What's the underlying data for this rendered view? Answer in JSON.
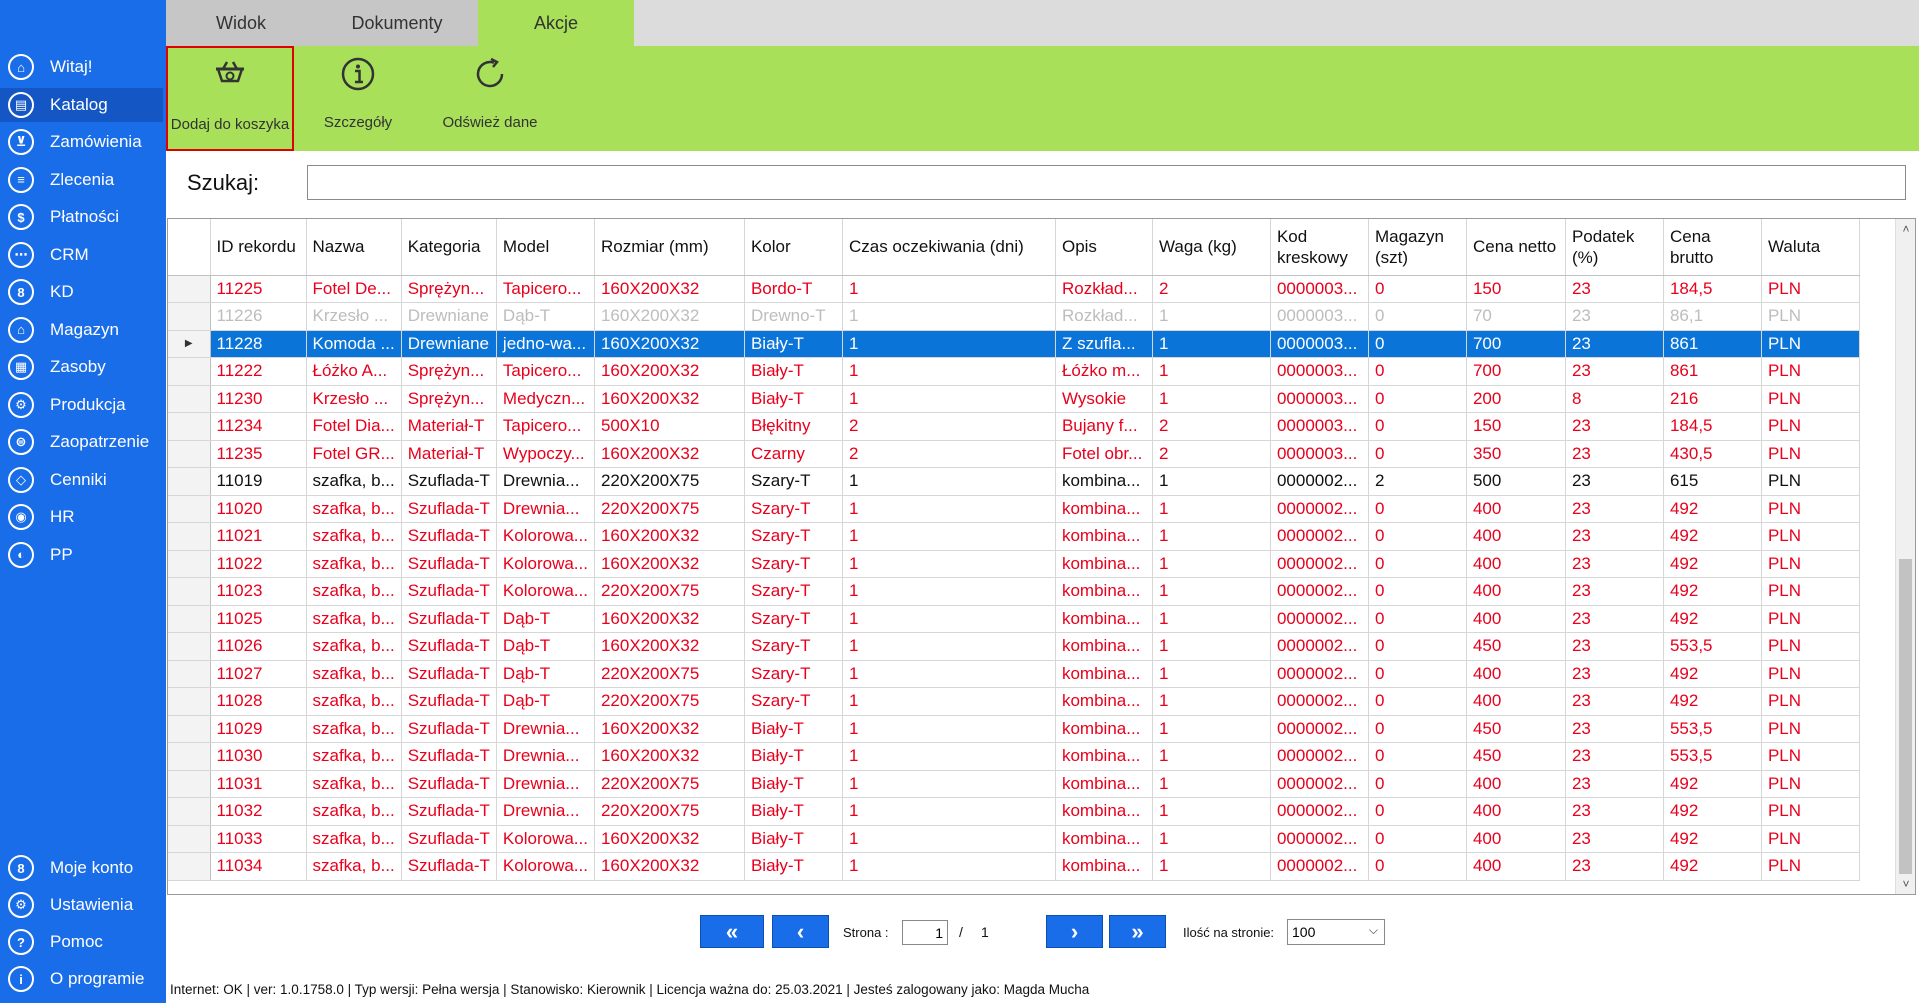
{
  "tabs": [
    "Widok",
    "Dokumenty",
    "Akcje"
  ],
  "ribbon": {
    "add_to_cart": "Dodaj do koszyka",
    "details": "Szczegóły",
    "refresh": "Odśwież dane",
    "icons": [
      "cart-icon",
      "info-icon",
      "refresh-icon"
    ]
  },
  "sidebar": {
    "items": [
      {
        "label": "Witaj!",
        "icon": "home-icon",
        "glyph": "⌂"
      },
      {
        "label": "Katalog",
        "icon": "book-icon",
        "glyph": "▤"
      },
      {
        "label": "Zamówienia",
        "icon": "cart-icon",
        "glyph": "⊻"
      },
      {
        "label": "Zlecenia",
        "icon": "list-icon",
        "glyph": "≡"
      },
      {
        "label": "Płatności",
        "icon": "dollar-icon",
        "glyph": "$"
      },
      {
        "label": "CRM",
        "icon": "crm-icon",
        "glyph": "⋯"
      },
      {
        "label": "KD",
        "icon": "person-icon",
        "glyph": "8"
      },
      {
        "label": "Magazyn",
        "icon": "warehouse-icon",
        "glyph": "⌂"
      },
      {
        "label": "Zasoby",
        "icon": "resources-icon",
        "glyph": "▦"
      },
      {
        "label": "Produkcja",
        "icon": "production-icon",
        "glyph": "⚙"
      },
      {
        "label": "Zaopatrzenie",
        "icon": "truck-icon",
        "glyph": "⊜"
      },
      {
        "label": "Cenniki",
        "icon": "tag-icon",
        "glyph": "◇"
      },
      {
        "label": "HR",
        "icon": "hr-icon",
        "glyph": "◉"
      },
      {
        "label": "PP",
        "icon": "pp-icon",
        "glyph": "◐"
      }
    ],
    "bottom_items": [
      {
        "label": "Moje konto",
        "icon": "account-icon",
        "glyph": "8"
      },
      {
        "label": "Ustawienia",
        "icon": "settings-icon",
        "glyph": "⚙"
      },
      {
        "label": "Pomoc",
        "icon": "help-icon",
        "glyph": "?"
      },
      {
        "label": "O programie",
        "icon": "about-icon",
        "glyph": "i"
      }
    ],
    "active_index": 1
  },
  "search": {
    "label": "Szukaj:",
    "value": ""
  },
  "table": {
    "columns": [
      "ID rekordu",
      "Nazwa",
      "Kategoria",
      "Model",
      "Rozmiar (mm)",
      "Kolor",
      "Czas oczekiwania (dni)",
      "Opis",
      "Waga (kg)",
      "Kod kreskowy",
      "Magazyn (szt)",
      "Cena netto",
      "Podatek (%)",
      "Cena brutto",
      "Waluta"
    ],
    "rows": [
      {
        "style": "red",
        "cells": [
          "11225",
          "Fotel De...",
          "Sprężyn...",
          "Tapicero...",
          "160X200X32",
          "Bordo-T",
          "1",
          "Rozkład...",
          "2",
          "0000003...",
          "0",
          "150",
          "23",
          "184,5",
          "PLN"
        ]
      },
      {
        "style": "grey",
        "cells": [
          "11226",
          "Krzesło ...",
          "Drewniane",
          "Dąb-T",
          "160X200X32",
          "Drewno-T",
          "1",
          "Rozkład...",
          "1",
          "0000003...",
          "0",
          "70",
          "23",
          "86,1",
          "PLN"
        ]
      },
      {
        "style": "selected",
        "cells": [
          "11228",
          "Komoda ...",
          "Drewniane",
          "jedno-wa...",
          "160X200X32",
          "Biały-T",
          "1",
          "Z szufla...",
          "1",
          "0000003...",
          "0",
          "700",
          "23",
          "861",
          "PLN"
        ]
      },
      {
        "style": "red",
        "cells": [
          "11222",
          "Łóżko A...",
          "Sprężyn...",
          "Tapicero...",
          "160X200X32",
          "Biały-T",
          "1",
          "Łóżko m...",
          "1",
          "0000003...",
          "0",
          "700",
          "23",
          "861",
          "PLN"
        ]
      },
      {
        "style": "red",
        "cells": [
          "11230",
          "Krzesło ...",
          "Sprężyn...",
          "Medyczn...",
          "160X200X32",
          "Biały-T",
          "1",
          "Wysokie",
          "1",
          "0000003...",
          "0",
          "200",
          "8",
          "216",
          "PLN"
        ]
      },
      {
        "style": "red",
        "cells": [
          "11234",
          "Fotel Dia...",
          "Materiał-T",
          "Tapicero...",
          "500X10",
          "Błękitny",
          "2",
          "Bujany f...",
          "2",
          "0000003...",
          "0",
          "150",
          "23",
          "184,5",
          "PLN"
        ]
      },
      {
        "style": "red",
        "cells": [
          "11235",
          "Fotel GR...",
          "Materiał-T",
          "Wypoczy...",
          "160X200X32",
          "Czarny",
          "2",
          "Fotel obr...",
          "2",
          "0000003...",
          "0",
          "350",
          "23",
          "430,5",
          "PLN"
        ]
      },
      {
        "style": "black",
        "cells": [
          "11019",
          "szafka, b...",
          "Szuflada-T",
          "Drewnia...",
          "220X200X75",
          "Szary-T",
          "1",
          "kombina...",
          "1",
          "0000002...",
          "2",
          "500",
          "23",
          "615",
          "PLN"
        ]
      },
      {
        "style": "red",
        "cells": [
          "11020",
          "szafka, b...",
          "Szuflada-T",
          "Drewnia...",
          "220X200X75",
          "Szary-T",
          "1",
          "kombina...",
          "1",
          "0000002...",
          "0",
          "400",
          "23",
          "492",
          "PLN"
        ]
      },
      {
        "style": "red",
        "cells": [
          "11021",
          "szafka, b...",
          "Szuflada-T",
          "Kolorowa...",
          "160X200X32",
          "Szary-T",
          "1",
          "kombina...",
          "1",
          "0000002...",
          "0",
          "400",
          "23",
          "492",
          "PLN"
        ]
      },
      {
        "style": "red",
        "cells": [
          "11022",
          "szafka, b...",
          "Szuflada-T",
          "Kolorowa...",
          "160X200X32",
          "Szary-T",
          "1",
          "kombina...",
          "1",
          "0000002...",
          "0",
          "400",
          "23",
          "492",
          "PLN"
        ]
      },
      {
        "style": "red",
        "cells": [
          "11023",
          "szafka, b...",
          "Szuflada-T",
          "Kolorowa...",
          "220X200X75",
          "Szary-T",
          "1",
          "kombina...",
          "1",
          "0000002...",
          "0",
          "400",
          "23",
          "492",
          "PLN"
        ]
      },
      {
        "style": "red",
        "cells": [
          "11025",
          "szafka, b...",
          "Szuflada-T",
          "Dąb-T",
          "160X200X32",
          "Szary-T",
          "1",
          "kombina...",
          "1",
          "0000002...",
          "0",
          "400",
          "23",
          "492",
          "PLN"
        ]
      },
      {
        "style": "red",
        "cells": [
          "11026",
          "szafka, b...",
          "Szuflada-T",
          "Dąb-T",
          "160X200X32",
          "Szary-T",
          "1",
          "kombina...",
          "1",
          "0000002...",
          "0",
          "450",
          "23",
          "553,5",
          "PLN"
        ]
      },
      {
        "style": "red",
        "cells": [
          "11027",
          "szafka, b...",
          "Szuflada-T",
          "Dąb-T",
          "220X200X75",
          "Szary-T",
          "1",
          "kombina...",
          "1",
          "0000002...",
          "0",
          "400",
          "23",
          "492",
          "PLN"
        ]
      },
      {
        "style": "red",
        "cells": [
          "11028",
          "szafka, b...",
          "Szuflada-T",
          "Dąb-T",
          "220X200X75",
          "Szary-T",
          "1",
          "kombina...",
          "1",
          "0000002...",
          "0",
          "400",
          "23",
          "492",
          "PLN"
        ]
      },
      {
        "style": "red",
        "cells": [
          "11029",
          "szafka, b...",
          "Szuflada-T",
          "Drewnia...",
          "160X200X32",
          "Biały-T",
          "1",
          "kombina...",
          "1",
          "0000002...",
          "0",
          "450",
          "23",
          "553,5",
          "PLN"
        ]
      },
      {
        "style": "red",
        "cells": [
          "11030",
          "szafka, b...",
          "Szuflada-T",
          "Drewnia...",
          "160X200X32",
          "Biały-T",
          "1",
          "kombina...",
          "1",
          "0000002...",
          "0",
          "450",
          "23",
          "553,5",
          "PLN"
        ]
      },
      {
        "style": "red",
        "cells": [
          "11031",
          "szafka, b...",
          "Szuflada-T",
          "Drewnia...",
          "220X200X75",
          "Biały-T",
          "1",
          "kombina...",
          "1",
          "0000002...",
          "0",
          "400",
          "23",
          "492",
          "PLN"
        ]
      },
      {
        "style": "red",
        "cells": [
          "11032",
          "szafka, b...",
          "Szuflada-T",
          "Drewnia...",
          "220X200X75",
          "Biały-T",
          "1",
          "kombina...",
          "1",
          "0000002...",
          "0",
          "400",
          "23",
          "492",
          "PLN"
        ]
      },
      {
        "style": "red",
        "cells": [
          "11033",
          "szafka, b...",
          "Szuflada-T",
          "Kolorowa...",
          "160X200X32",
          "Biały-T",
          "1",
          "kombina...",
          "1",
          "0000002...",
          "0",
          "400",
          "23",
          "492",
          "PLN"
        ]
      },
      {
        "style": "red",
        "cells": [
          "11034",
          "szafka, b...",
          "Szuflada-T",
          "Kolorowa...",
          "160X200X32",
          "Biały-T",
          "1",
          "kombina...",
          "1",
          "0000002...",
          "0",
          "400",
          "23",
          "492",
          "PLN"
        ]
      }
    ]
  },
  "pager": {
    "first": "«",
    "prev": "‹",
    "next": "›",
    "last": "»",
    "page_label": "Strona :",
    "page": "1",
    "separator": "/",
    "total": "1",
    "per_page_label": "Ilość na stronie:",
    "per_page": "100"
  },
  "status": "Internet: OK  |   ver: 1.0.1758.0   |   Typ wersji: Pełna wersja   |   Stanowisko: Kierownik   |   Licencja ważna do: 25.03.2021   |   Jesteś zalogowany jako: Magda Mucha",
  "colors": {
    "sidebar": "#1a6de8",
    "ribbon": "#a8e05a",
    "selected_row": "#0a74d8",
    "red_text": "#e8001c",
    "highlight_border": "#e00000"
  }
}
